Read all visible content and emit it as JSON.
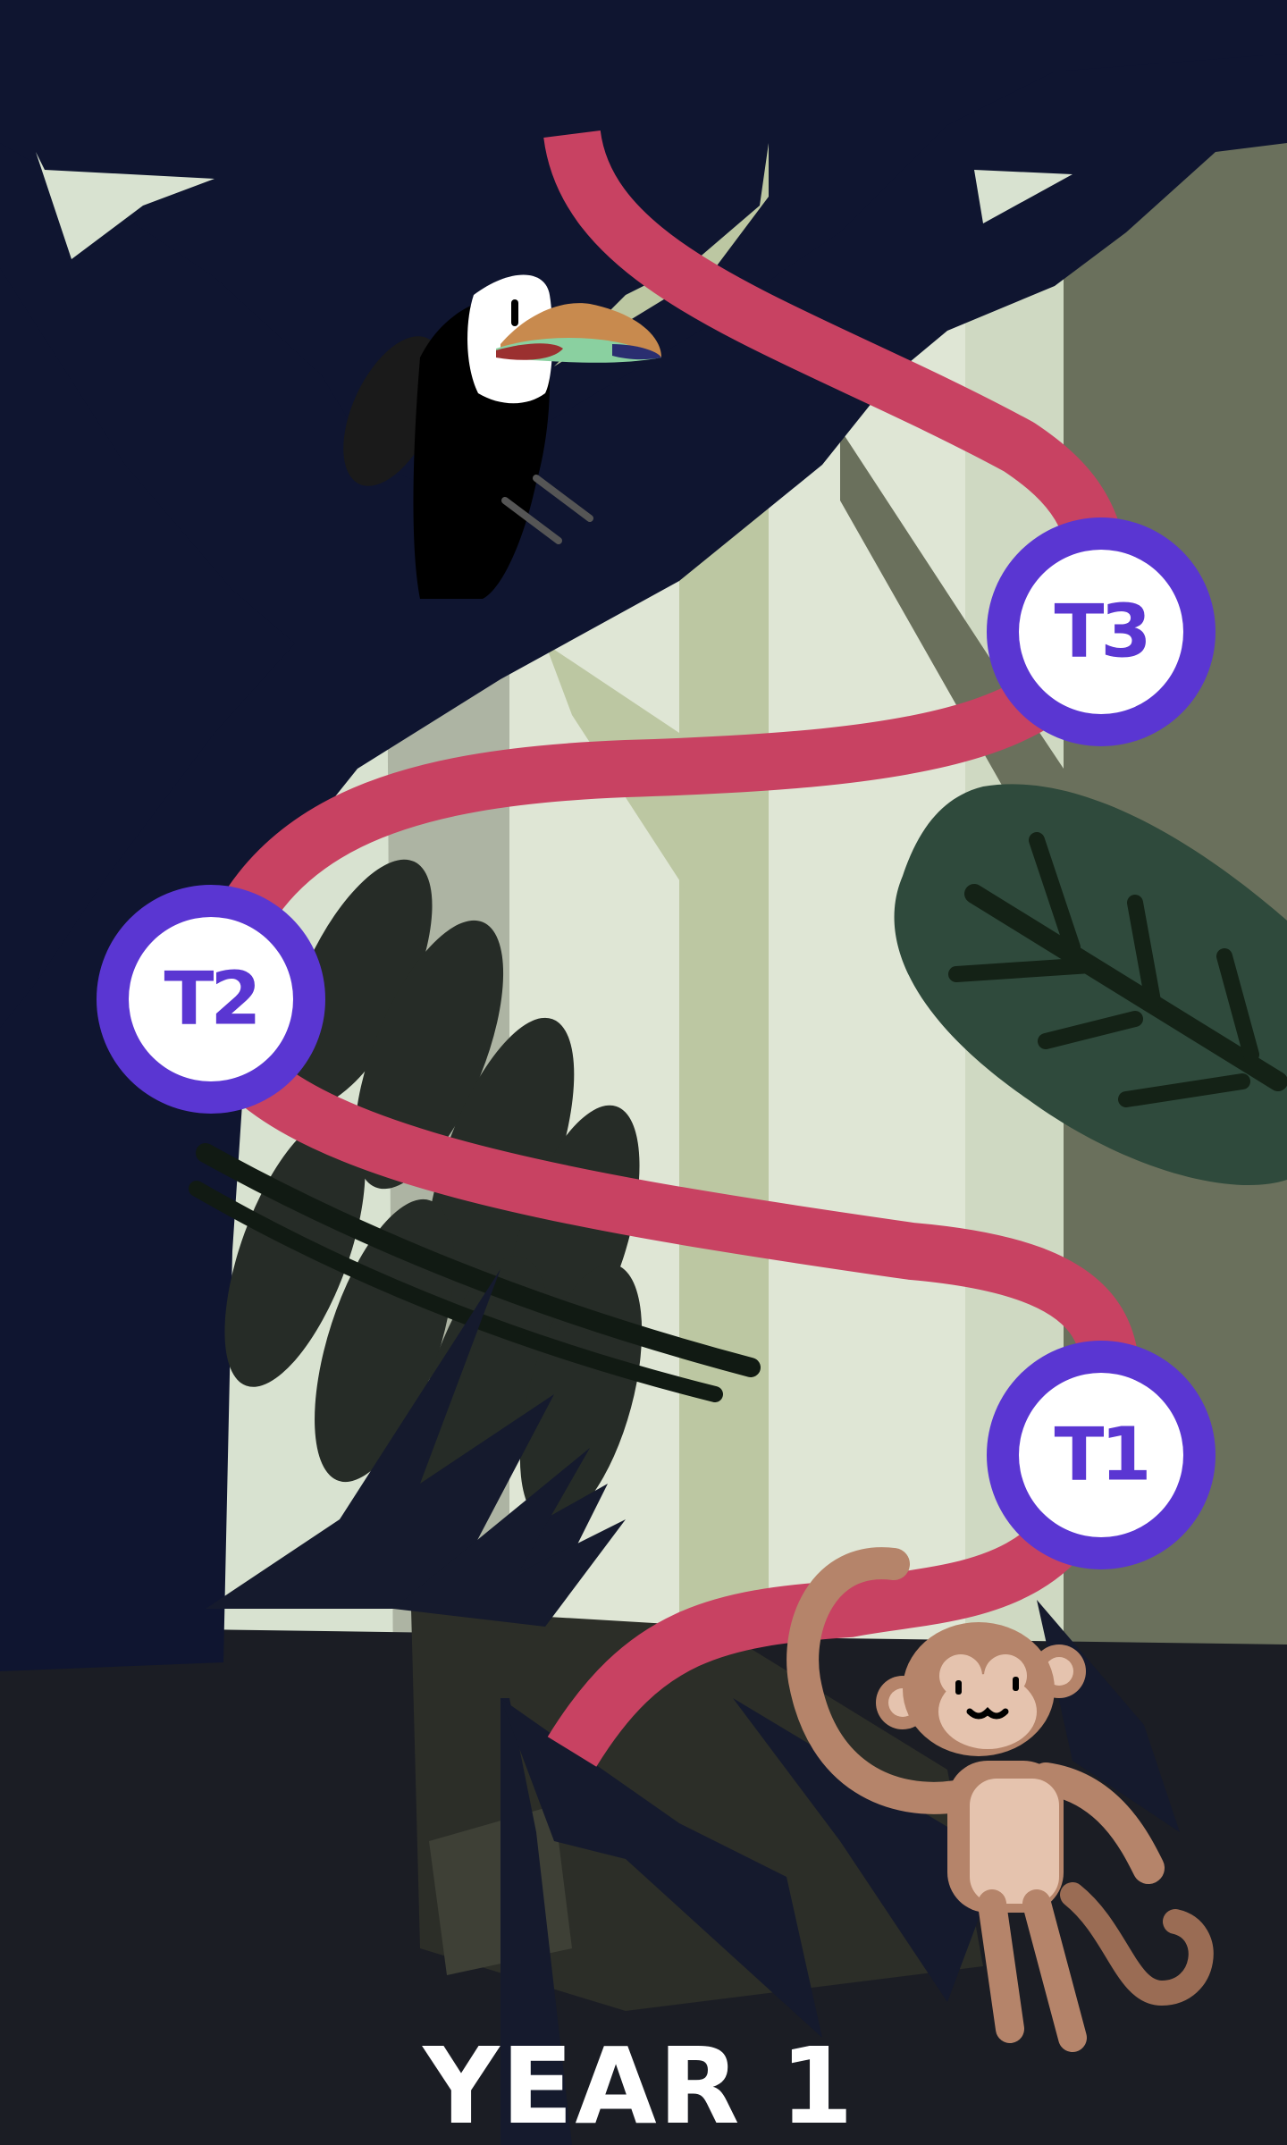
{
  "level": {
    "title": "YEAR 1",
    "nodes": [
      {
        "id": "t1",
        "label": "T1"
      },
      {
        "id": "t2",
        "label": "T2"
      },
      {
        "id": "t3",
        "label": "T3"
      }
    ]
  },
  "colors": {
    "night_sky": "#0f1530",
    "path": "#c84262",
    "node_ring": "#5a36d2",
    "node_fill": "#ffffff",
    "node_text": "#5a36d2",
    "title_text": "#ffffff"
  },
  "characters": {
    "top": "toucan-icon",
    "bottom": "monkey-icon"
  }
}
